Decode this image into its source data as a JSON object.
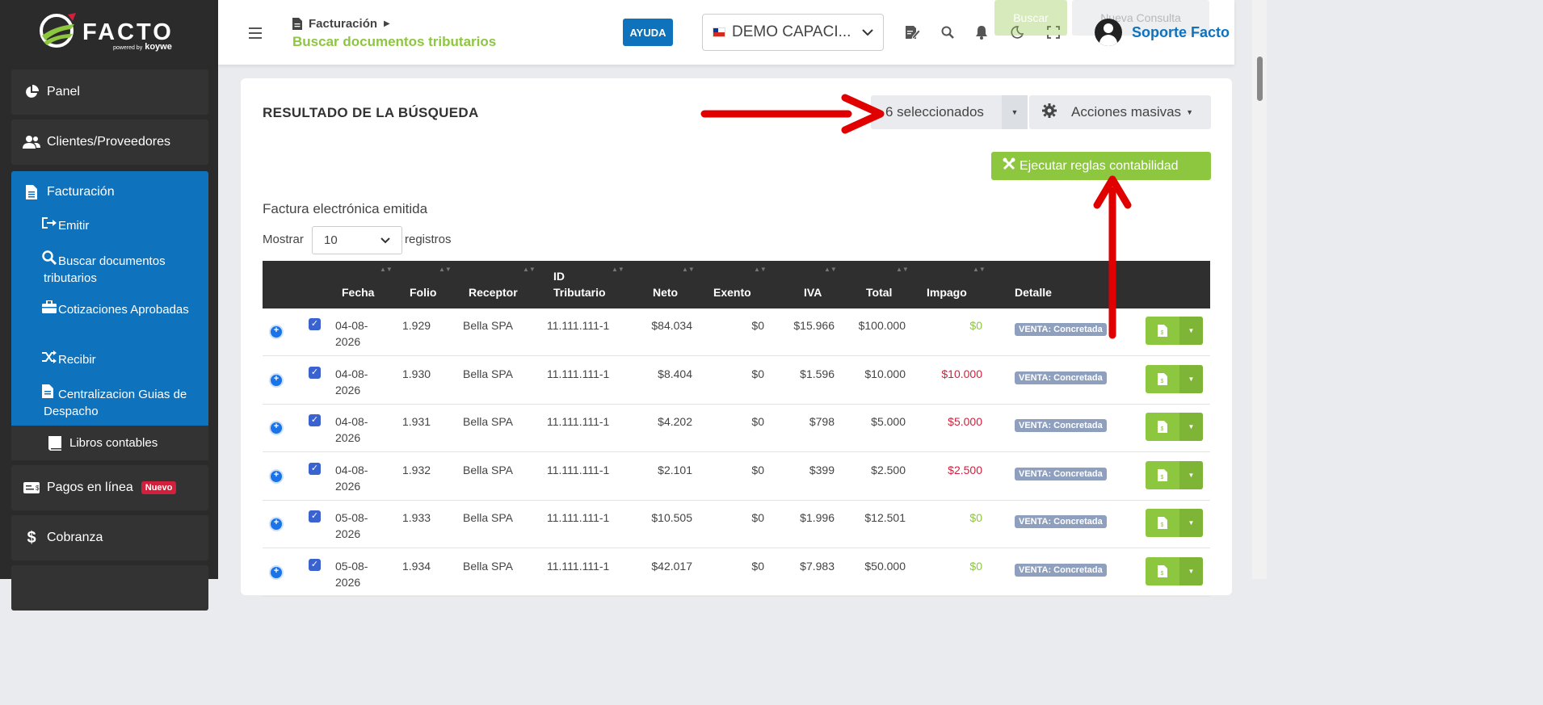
{
  "brand": {
    "name": "FACTO",
    "powered_small": "powered by",
    "powered_brand": "koywe"
  },
  "sidebar": {
    "items": [
      {
        "label": "Panel",
        "icon": "pie-chart-icon"
      },
      {
        "label": "Clientes/Proveedores",
        "icon": "users-icon"
      },
      {
        "label": "Facturación",
        "icon": "file-icon"
      }
    ],
    "sub_items": [
      {
        "label": "Emitir",
        "icon": "sign-out-icon"
      },
      {
        "label": "Buscar documentos tributarios",
        "icon": "search-icon"
      },
      {
        "label": "Cotizaciones Aprobadas",
        "icon": "briefcase-icon"
      },
      {
        "label": "Recibir",
        "icon": "shuffle-icon"
      },
      {
        "label": "Centralizacion Guias de Despacho",
        "icon": "file-icon"
      }
    ],
    "libros": "Libros contables",
    "pagos": "Pagos en línea",
    "pagos_badge": "Nuevo",
    "cobranza": "Cobranza"
  },
  "header": {
    "breadcrumb_parent": "Facturación",
    "breadcrumb_current": "Buscar documentos tributarios",
    "help": "AYUDA",
    "company": "DEMO CAPACI...",
    "ghost_1": "Buscar",
    "ghost_2": "Nueva Consulta",
    "user": "Soporte Facto"
  },
  "results": {
    "title": "RESULTADO DE LA BÚSQUEDA",
    "selected": "6 seleccionados",
    "mass_actions": "Acciones masivas",
    "execute": "Ejecutar reglas contabilidad",
    "section": "Factura electrónica emitida",
    "show_label": "Mostrar",
    "page_size": "10",
    "records_label": "registros"
  },
  "table": {
    "headers": {
      "fecha": "Fecha",
      "folio": "Folio",
      "receptor": "Receptor",
      "id_line1": "ID",
      "id_line2": "Tributario",
      "neto": "Neto",
      "exento": "Exento",
      "iva": "IVA",
      "total": "Total",
      "impago": "Impago",
      "detalle": "Detalle"
    },
    "rows": [
      {
        "fecha_1": "04-08-",
        "fecha_2": "2026",
        "folio": "1.929",
        "receptor": "Bella SPA",
        "id": "11.111.111-1",
        "neto": "$84.034",
        "exento": "$0",
        "iva": "$15.966",
        "total": "$100.000",
        "impago": "$0",
        "impago_status": "paid",
        "detalle": "VENTA: Concretada"
      },
      {
        "fecha_1": "04-08-",
        "fecha_2": "2026",
        "folio": "1.930",
        "receptor": "Bella SPA",
        "id": "11.111.111-1",
        "neto": "$8.404",
        "exento": "$0",
        "iva": "$1.596",
        "total": "$10.000",
        "impago": "$10.000",
        "impago_status": "due",
        "detalle": "VENTA: Concretada"
      },
      {
        "fecha_1": "04-08-",
        "fecha_2": "2026",
        "folio": "1.931",
        "receptor": "Bella SPA",
        "id": "11.111.111-1",
        "neto": "$4.202",
        "exento": "$0",
        "iva": "$798",
        "total": "$5.000",
        "impago": "$5.000",
        "impago_status": "due",
        "detalle": "VENTA: Concretada"
      },
      {
        "fecha_1": "04-08-",
        "fecha_2": "2026",
        "folio": "1.932",
        "receptor": "Bella SPA",
        "id": "11.111.111-1",
        "neto": "$2.101",
        "exento": "$0",
        "iva": "$399",
        "total": "$2.500",
        "impago": "$2.500",
        "impago_status": "due",
        "detalle": "VENTA: Concretada"
      },
      {
        "fecha_1": "05-08-",
        "fecha_2": "2026",
        "folio": "1.933",
        "receptor": "Bella SPA",
        "id": "11.111.111-1",
        "neto": "$10.505",
        "exento": "$0",
        "iva": "$1.996",
        "total": "$12.501",
        "impago": "$0",
        "impago_status": "paid",
        "detalle": "VENTA: Concretada"
      },
      {
        "fecha_1": "05-08-",
        "fecha_2": "2026",
        "folio": "1.934",
        "receptor": "Bella SPA",
        "id": "11.111.111-1",
        "neto": "$42.017",
        "exento": "$0",
        "iva": "$7.983",
        "total": "$50.000",
        "impago": "$0",
        "impago_status": "paid",
        "detalle": "VENTA: Concretada"
      }
    ]
  },
  "colors": {
    "brand_green": "#8dc63f",
    "brand_blue": "#0f72bd",
    "alert_red": "#d11f3c",
    "annotation_red": "#e00000"
  }
}
